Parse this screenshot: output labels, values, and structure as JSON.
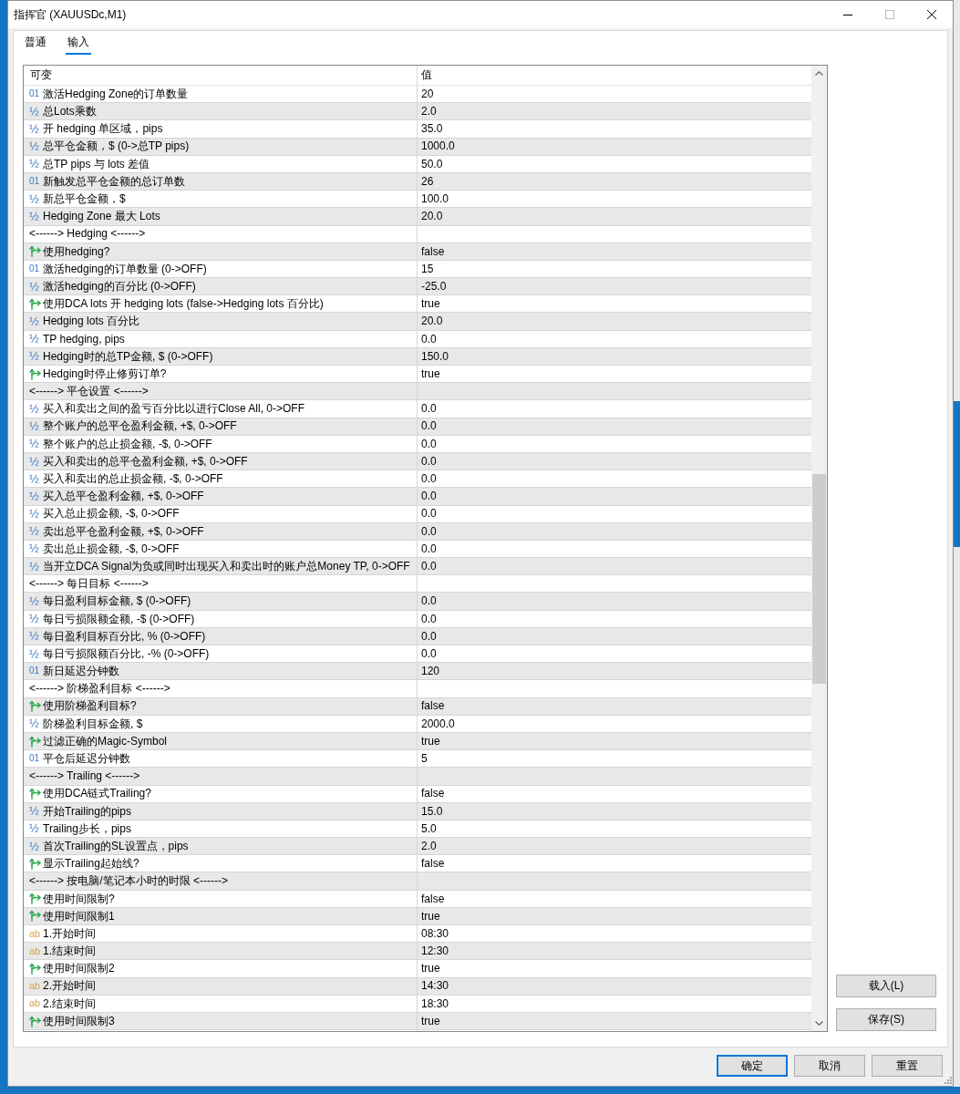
{
  "window": {
    "title": "指挥官 (XAUUSDc,M1)"
  },
  "tabs": [
    {
      "label": "普通",
      "selected": false
    },
    {
      "label": "输入",
      "selected": true
    }
  ],
  "inputs_table": {
    "columns": [
      "可变",
      "值"
    ],
    "rows": [
      {
        "kind": "int",
        "type_glyph": "01",
        "name": "激活Hedging Zone的订单数量",
        "value": "20"
      },
      {
        "kind": "double",
        "type_glyph": "½",
        "name": "总Lots乘数",
        "value": "2.0"
      },
      {
        "kind": "double",
        "type_glyph": "½",
        "name": "开 hedging 单区域，pips",
        "value": "35.0"
      },
      {
        "kind": "double",
        "type_glyph": "½",
        "name": "总平仓金额，$ (0->总TP pips)",
        "value": "1000.0"
      },
      {
        "kind": "double",
        "type_glyph": "½",
        "name": "总TP pips 与 lots 差值",
        "value": "50.0"
      },
      {
        "kind": "int",
        "type_glyph": "01",
        "name": "新触发总平仓金额的总订单数",
        "value": "26"
      },
      {
        "kind": "double",
        "type_glyph": "½",
        "name": "新总平仓金额，$",
        "value": "100.0"
      },
      {
        "kind": "double",
        "type_glyph": "½",
        "name": "Hedging Zone 最大 Lots",
        "value": "20.0"
      },
      {
        "kind": "separator",
        "name": "<------> Hedging <------>"
      },
      {
        "kind": "bool",
        "name": "使用hedging?",
        "value": "false"
      },
      {
        "kind": "int",
        "type_glyph": "01",
        "name": "激活hedging的订单数量 (0->OFF)",
        "value": "15"
      },
      {
        "kind": "double",
        "type_glyph": "½",
        "name": "激活hedging的百分比 (0->OFF)",
        "value": "-25.0"
      },
      {
        "kind": "bool",
        "name": "使用DCA lots 开 hedging lots (false->Hedging lots 百分比)",
        "value": "true"
      },
      {
        "kind": "double",
        "type_glyph": "½",
        "name": "Hedging lots 百分比",
        "value": "20.0"
      },
      {
        "kind": "double",
        "type_glyph": "½",
        "name": "TP hedging, pips",
        "value": "0.0"
      },
      {
        "kind": "double",
        "type_glyph": "½",
        "name": "Hedging时的总TP金额, $ (0->OFF)",
        "value": "150.0"
      },
      {
        "kind": "bool",
        "name": "Hedging时停止修剪订单?",
        "value": "true"
      },
      {
        "kind": "separator",
        "name": "<------> 平仓设置 <------>"
      },
      {
        "kind": "double",
        "type_glyph": "½",
        "name": "买入和卖出之间的盈亏百分比以进行Close All, 0->OFF",
        "value": "0.0"
      },
      {
        "kind": "double",
        "type_glyph": "½",
        "name": "整个账户的总平仓盈利金额, +$, 0->OFF",
        "value": "0.0"
      },
      {
        "kind": "double",
        "type_glyph": "½",
        "name": "整个账户的总止损金额, -$, 0->OFF",
        "value": "0.0"
      },
      {
        "kind": "double",
        "type_glyph": "½",
        "name": "买入和卖出的总平仓盈利金额, +$, 0->OFF",
        "value": "0.0"
      },
      {
        "kind": "double",
        "type_glyph": "½",
        "name": "买入和卖出的总止损金额, -$, 0->OFF",
        "value": "0.0"
      },
      {
        "kind": "double",
        "type_glyph": "½",
        "name": "买入总平仓盈利金额, +$, 0->OFF",
        "value": "0.0"
      },
      {
        "kind": "double",
        "type_glyph": "½",
        "name": "买入总止损金额, -$, 0->OFF",
        "value": "0.0"
      },
      {
        "kind": "double",
        "type_glyph": "½",
        "name": "卖出总平仓盈利金额, +$, 0->OFF",
        "value": "0.0"
      },
      {
        "kind": "double",
        "type_glyph": "½",
        "name": "卖出总止损金额, -$, 0->OFF",
        "value": "0.0"
      },
      {
        "kind": "double",
        "type_glyph": "½",
        "name": "当开立DCA Signal为负或同时出现买入和卖出时的账户总Money TP, 0->OFF",
        "value": "0.0"
      },
      {
        "kind": "separator",
        "name": "<------> 每日目标 <------>"
      },
      {
        "kind": "double",
        "type_glyph": "½",
        "name": "每日盈利目标金额, $ (0->OFF)",
        "value": "0.0"
      },
      {
        "kind": "double",
        "type_glyph": "½",
        "name": "每日亏损限额金额, -$ (0->OFF)",
        "value": "0.0"
      },
      {
        "kind": "double",
        "type_glyph": "½",
        "name": "每日盈利目标百分比, % (0->OFF)",
        "value": "0.0"
      },
      {
        "kind": "double",
        "type_glyph": "½",
        "name": "每日亏损限额百分比, -% (0->OFF)",
        "value": "0.0"
      },
      {
        "kind": "int",
        "type_glyph": "01",
        "name": "新日延迟分钟数",
        "value": "120"
      },
      {
        "kind": "separator",
        "name": "<------> 阶梯盈利目标 <------>"
      },
      {
        "kind": "bool",
        "name": "使用阶梯盈利目标?",
        "value": "false"
      },
      {
        "kind": "double",
        "type_glyph": "½",
        "name": "阶梯盈利目标金额, $",
        "value": "2000.0"
      },
      {
        "kind": "bool",
        "name": "过滤正确的Magic-Symbol",
        "value": "true"
      },
      {
        "kind": "int",
        "type_glyph": "01",
        "name": "平仓后延迟分钟数",
        "value": "5"
      },
      {
        "kind": "separator",
        "name": "<------> Trailing <------>"
      },
      {
        "kind": "bool",
        "name": "使用DCA链式Trailing?",
        "value": "false"
      },
      {
        "kind": "double",
        "type_glyph": "½",
        "name": "开始Trailing的pips",
        "value": "15.0"
      },
      {
        "kind": "double",
        "type_glyph": "½",
        "name": "Trailing步长，pips",
        "value": "5.0"
      },
      {
        "kind": "double",
        "type_glyph": "½",
        "name": "首次Trailing的SL设置点，pips",
        "value": "2.0"
      },
      {
        "kind": "bool",
        "name": "显示Trailing起始线?",
        "value": "false"
      },
      {
        "kind": "separator",
        "name": "<------> 按电脑/笔记本小时的时限 <------>"
      },
      {
        "kind": "bool",
        "name": "使用时间限制?",
        "value": "false"
      },
      {
        "kind": "bool",
        "name": "使用时间限制1",
        "value": "true"
      },
      {
        "kind": "string",
        "type_glyph": "ab",
        "name": "1.开始时间",
        "value": "08:30"
      },
      {
        "kind": "string",
        "type_glyph": "ab",
        "name": "1.结束时间",
        "value": "12:30"
      },
      {
        "kind": "bool",
        "name": "使用时间限制2",
        "value": "true"
      },
      {
        "kind": "string",
        "type_glyph": "ab",
        "name": "2.开始时间",
        "value": "14:30"
      },
      {
        "kind": "string",
        "type_glyph": "ab",
        "name": "2.结束时间",
        "value": "18:30"
      },
      {
        "kind": "bool",
        "name": "使用时间限制3",
        "value": "true"
      }
    ]
  },
  "side_buttons": [
    "载入(L)",
    "保存(S)"
  ],
  "dialog_buttons": [
    {
      "label": "确定",
      "focused": true
    },
    {
      "label": "取消",
      "focused": false
    },
    {
      "label": "重置",
      "focused": false
    }
  ]
}
